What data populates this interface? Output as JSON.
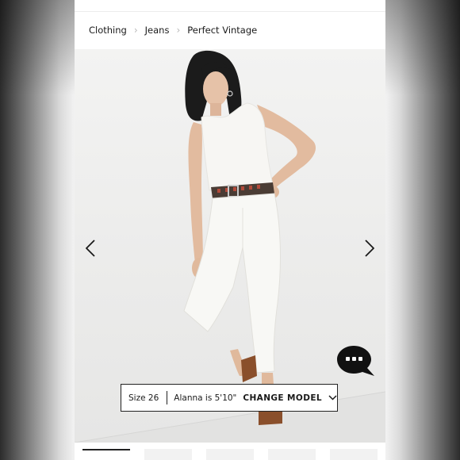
{
  "breadcrumb": {
    "items": [
      "Clothing",
      "Jeans",
      "Perfect Vintage"
    ]
  },
  "gallery": {
    "prev_icon": "chevron-left-icon",
    "next_icon": "chevron-right-icon"
  },
  "model_info": {
    "size_label": "Size 26",
    "model_label": "Alanna is 5'10\"",
    "change_label": "CHANGE MODEL",
    "dropdown_icon": "chevron-down-icon"
  },
  "chat": {
    "icon": "chat-bubble-icon"
  },
  "colors": {
    "text": "#1a1a1a",
    "border": "#222222",
    "chat_bg": "#111111"
  }
}
